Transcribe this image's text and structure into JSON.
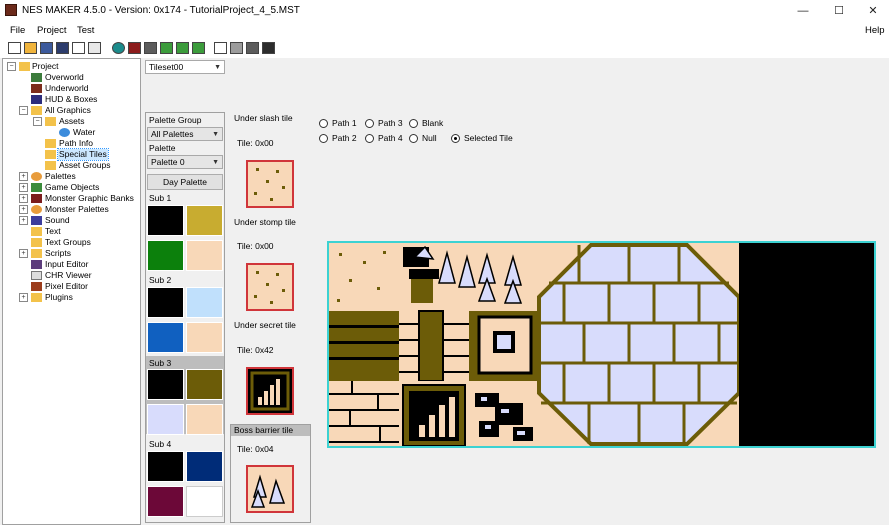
{
  "window": {
    "title": "NES MAKER 4.5.0 - Version: 0x174 - TutorialProject_4_5.MST",
    "minimize": "—",
    "maximize": "☐",
    "close": "✕"
  },
  "menu": {
    "file": "File",
    "project": "Project",
    "test": "Test",
    "help": "Help"
  },
  "tree": {
    "project": "Project",
    "overworld": "Overworld",
    "underworld": "Underworld",
    "hud": "HUD & Boxes",
    "all_graphics": "All Graphics",
    "assets": "Assets",
    "water": "Water",
    "path_info": "Path Info",
    "special_tiles": "Special Tiles",
    "asset_groups": "Asset Groups",
    "palettes": "Palettes",
    "game_objects": "Game Objects",
    "monster_graphic_banks": "Monster Graphic Banks",
    "monster_palettes": "Monster Palettes",
    "sound": "Sound",
    "text": "Text",
    "text_groups": "Text Groups",
    "scripts": "Scripts",
    "input_editor": "Input Editor",
    "chr_viewer": "CHR Viewer",
    "pixel_editor": "Pixel Editor",
    "plugins": "Plugins"
  },
  "tileset_select": "Tileset00",
  "palette_panel": {
    "group_label": "Palette Group",
    "group_value": "All Palettes",
    "palette_label": "Palette",
    "palette_value": "Palette 0",
    "day_button": "Day Palette",
    "sub1": "Sub 1",
    "sub2": "Sub 2",
    "sub3": "Sub 3",
    "sub4": "Sub 4",
    "sub1_colors": [
      "#000000",
      "#c8ac30",
      "#0c800c",
      "#f8d8b8"
    ],
    "sub2_colors": [
      "#000000",
      "#c0e0fc",
      "#1060c0",
      "#f8d8b8"
    ],
    "sub3_colors": [
      "#000000",
      "#6c5c08",
      "#d8dcfc",
      "#f8d8b8"
    ],
    "sub4_colors": [
      "#000000",
      "#002c78",
      "#6c0838",
      "#ffffff"
    ]
  },
  "special": {
    "under_slash": "Under slash tile",
    "under_slash_tile": "Tile: 0x00",
    "under_stomp": "Under stomp tile",
    "under_stomp_tile": "Tile: 0x00",
    "under_secret": "Under secret tile",
    "under_secret_tile": "Tile: 0x42",
    "boss_barrier": "Boss barrier tile",
    "boss_barrier_tile": "Tile: 0x04"
  },
  "radios": {
    "path1": "Path 1",
    "path2": "Path 2",
    "path3": "Path 3",
    "path4": "Path 4",
    "blank": "Blank",
    "null": "Null",
    "selected": "Selected Tile",
    "selected_value": "Selected Tile"
  },
  "colors": {
    "sand": "#f8d8b8",
    "olive": "#6c5c08",
    "stone": "#d8dcfc",
    "stone_dark": "#3c3c9c",
    "canvas_border": "#3cd2d2",
    "tile_border": "#d0353a"
  },
  "icons": {
    "app": "nes-maker-icon",
    "folder": "folder-icon"
  }
}
